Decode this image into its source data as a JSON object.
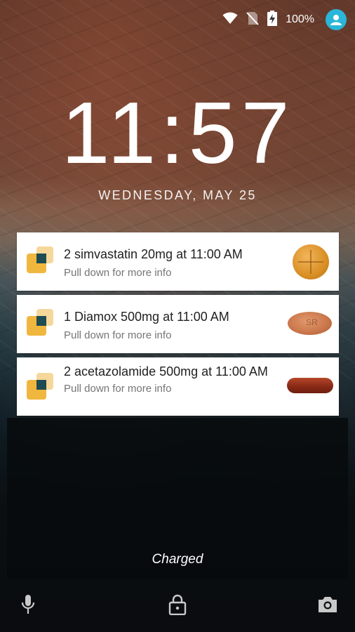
{
  "status_bar": {
    "battery_percent": "100%",
    "icons": [
      "wifi-icon",
      "no-sim-icon",
      "battery-charging-icon",
      "user-avatar-icon"
    ]
  },
  "lockscreen": {
    "time": "11:57",
    "date": "WEDNESDAY, MAY 25"
  },
  "notifications": [
    {
      "title": "2 simvastatin 20mg at 11:00 AM",
      "subtitle": "Pull down for more info",
      "pill": "round-orange-tablet"
    },
    {
      "title": "1 Diamox 500mg at 11:00 AM",
      "subtitle": "Pull down for more info",
      "pill": "oval-orange-tablet",
      "pill_imprint": "SR"
    },
    {
      "title": "2 acetazolamide 500mg at 11:00 AM",
      "subtitle": "Pull down for more info",
      "pill": "red-capsule"
    }
  ],
  "charging_status": "Charged",
  "bottom_actions": [
    "microphone-icon",
    "lock-icon",
    "camera-icon"
  ],
  "colors": {
    "accent": "#29b6d8",
    "app_icon_yellow": "#f0b73e",
    "app_icon_teal": "#1f4b53"
  }
}
